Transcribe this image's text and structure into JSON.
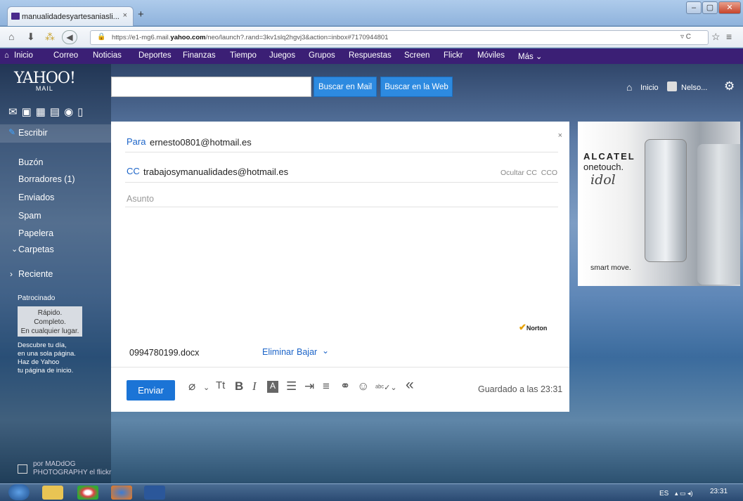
{
  "browser": {
    "tab_title": "manualidadesyartesaniasli...",
    "tab_close": "×",
    "new_tab": "+",
    "url_prefix": "https://e1-mg6.mail.",
    "url_domain": "yahoo.com",
    "url_suffix": "/neo/launch?.rand=3kv1slq2hgvj3&action=inbox#7170944801"
  },
  "yahoo_menu": [
    "Inicio",
    "Correo",
    "Noticias",
    "Deportes",
    "Finanzas",
    "Tiempo",
    "Juegos",
    "Grupos",
    "Respuestas",
    "Screen",
    "Flickr",
    "Móviles",
    "Más ⌄"
  ],
  "header": {
    "logo": "YAHOO!",
    "logo_sub": "MAIL",
    "search_mail": "Buscar en Mail",
    "search_web": "Buscar en la Web",
    "home": "Inicio",
    "user": "Nelso..."
  },
  "sidebar": {
    "compose": "Escribir",
    "items": [
      "Buzón",
      "Borradores (1)",
      "Enviados",
      "Spam",
      "Papelera"
    ],
    "folders": "Carpetas",
    "recent": "Reciente",
    "sponsored": "Patrocinado",
    "ad_lines": [
      "Rápido.",
      "Completo.",
      "En cualquier lugar."
    ],
    "promo": [
      "Descubre tu día,",
      "en una sola página.",
      "Haz de Yahoo",
      "tu página de inicio."
    ],
    "credit": [
      "por MADdOG",
      "PHOTOGRAPHY el flickr"
    ]
  },
  "compose": {
    "close": "×",
    "to_label": "Para",
    "to_value": "ernesto0801@hotmail.es",
    "cc_label": "CC",
    "cc_value": "trabajosymanualidades@hotmail.es",
    "cc_actions": "Ocultar CC  CCO",
    "subject_placeholder": "Asunto",
    "norton": "Norton",
    "attachment": "0994780199.docx",
    "remove": "Eliminar",
    "download": "Bajar",
    "send": "Enviar",
    "saved": "Guardado a las 23:31"
  },
  "ad": {
    "brand1": "ALCATEL",
    "brand2": "onetouch.",
    "model": "idol",
    "slogan": "smart move."
  },
  "taskbar": {
    "lang": "ES",
    "time": "23:31"
  }
}
